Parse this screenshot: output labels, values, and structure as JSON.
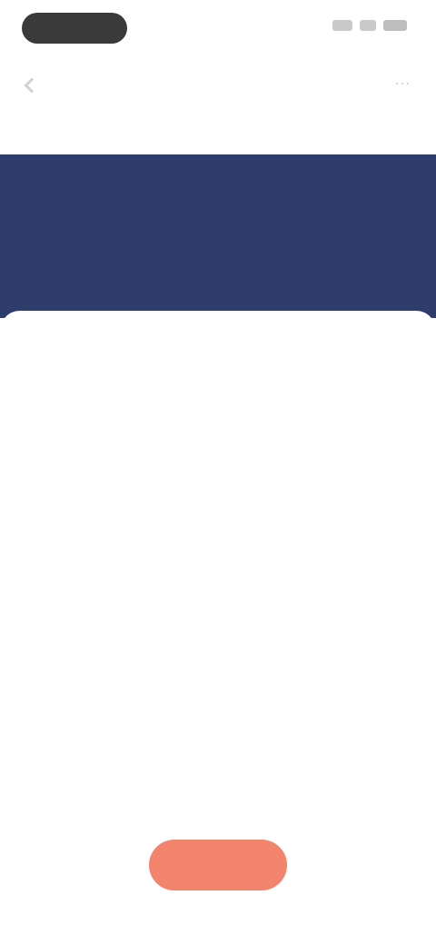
{
  "nav": {
    "title": "",
    "back_icon": "chevron-left-icon",
    "more_label": "···"
  },
  "tabs": [
    "",
    "",
    "",
    "",
    ""
  ],
  "banner": {
    "title": "",
    "subtitle": "",
    "stats": [
      "",
      "",
      "",
      ""
    ],
    "background": "#2f3d6c"
  },
  "card": {
    "label": "",
    "value": "",
    "detail": ""
  },
  "primary_button": {
    "label": "",
    "color": "#f2836d"
  }
}
